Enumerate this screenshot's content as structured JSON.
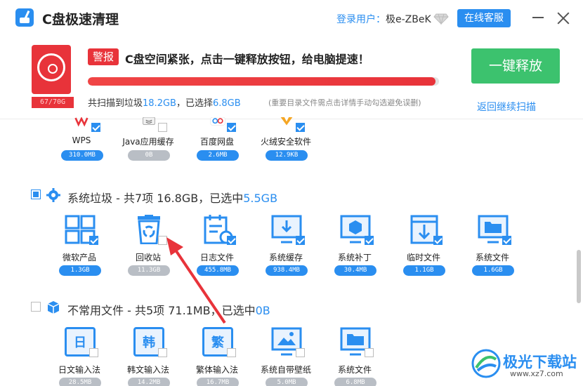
{
  "titlebar": {
    "app_title": "C盘极速清理",
    "user_label": "登录用户：",
    "user_name": "极e-ZBeK",
    "service_label": "在线客服"
  },
  "alert": {
    "disk_usage": "67/70G",
    "badge": "警报",
    "message": "C盘空间紧张，点击一键释放按钮，给电脑提速！",
    "progress_percent": 99,
    "summary_prefix": "共扫描到垃圾",
    "summary_total": "18.2GB",
    "summary_mid": "，已选择",
    "summary_selected": "6.8GB",
    "note": "(重要目录文件需点击详情手动勾选避免误删)",
    "release_label": "一键释放",
    "rescan_label": "返回继续扫描"
  },
  "software_items": [
    {
      "label": "WPS",
      "size": "310.0MB",
      "checked": true
    },
    {
      "label": "Java应用缓存",
      "size": "0B",
      "checked": false
    },
    {
      "label": "百度网盘",
      "size": "2.6MB",
      "checked": true
    },
    {
      "label": "火绒安全软件",
      "size": "12.9KB",
      "checked": true
    }
  ],
  "system_section": {
    "title_prefix": "系统垃圾 - 共7项 16.8GB，已选中",
    "selected": "5.5GB",
    "items": [
      {
        "label": "微软产品",
        "size": "1.3GB",
        "checked": true
      },
      {
        "label": "回收站",
        "size": "11.3GB",
        "checked": false
      },
      {
        "label": "日志文件",
        "size": "455.8MB",
        "checked": true
      },
      {
        "label": "系统缓存",
        "size": "938.4MB",
        "checked": true
      },
      {
        "label": "系统补丁",
        "size": "30.4MB",
        "checked": true
      },
      {
        "label": "临时文件",
        "size": "1.1GB",
        "checked": true
      },
      {
        "label": "系统文件",
        "size": "1.6GB",
        "checked": true
      }
    ]
  },
  "rare_section": {
    "title_prefix": "不常用文件 - 共5项 71.1MB，已选中",
    "selected": "0B",
    "items": [
      {
        "label": "日文输入法",
        "size": "28.5MB",
        "glyph": "日"
      },
      {
        "label": "韩文输入法",
        "size": "14.2MB",
        "glyph": "韩"
      },
      {
        "label": "繁体输入法",
        "size": "16.7MB",
        "glyph": "繁"
      },
      {
        "label": "系统自带壁纸",
        "size": "5.0MB"
      },
      {
        "label": "系统文件",
        "size": "6.8MB"
      }
    ]
  },
  "watermark": {
    "text": "极光下载站",
    "url": "www.xz7.com"
  },
  "colors": {
    "accent": "#2a8ef0",
    "alert_red": "#e8333a",
    "release_green": "#3cc26e"
  }
}
